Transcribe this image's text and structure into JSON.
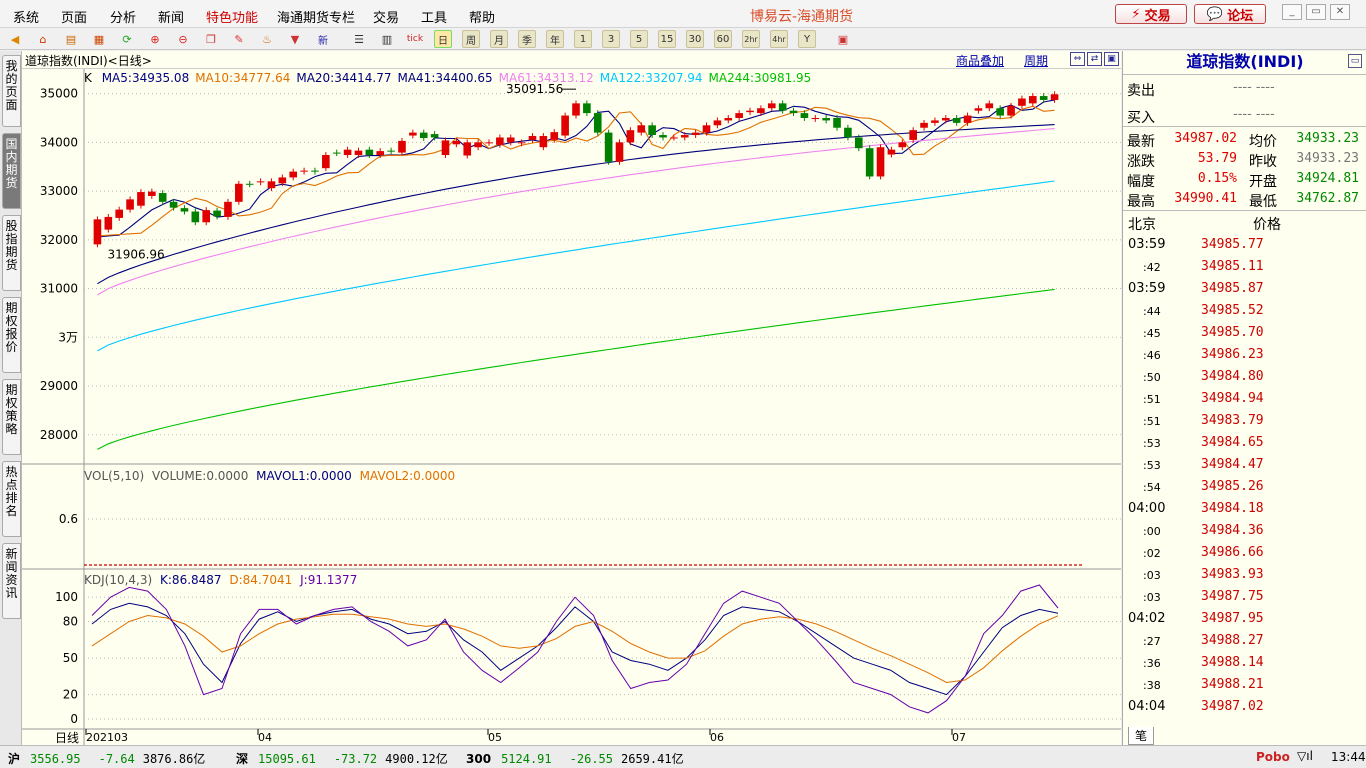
{
  "menu": [
    "系统",
    "页面",
    "分析",
    "新闻",
    "特色功能",
    "海通期货专栏",
    "交易",
    "工具",
    "帮助"
  ],
  "app_title": "博易云-海通期货",
  "top_buttons": {
    "trade": "交易",
    "forum": "论坛"
  },
  "toolbar": {
    "periods": [
      "日",
      "周",
      "月",
      "季",
      "年",
      "1",
      "3",
      "5",
      "15",
      "30",
      "60",
      "2hr",
      "4hr",
      "Y"
    ]
  },
  "sidebar": [
    "我的页面",
    "国内期货",
    "股指期货",
    "期权报价",
    "期权策略",
    "热点排名",
    "新闻资讯"
  ],
  "chart": {
    "title": "道琼指数(INDI)<日线>",
    "header_links": [
      "商品叠加",
      "周期"
    ],
    "ma_line": {
      "k": "K",
      "items": [
        {
          "text": "MA5:34935.08",
          "color": "#000080"
        },
        {
          "text": "MA10:34777.64",
          "color": "#e07000"
        },
        {
          "text": "MA20:34414.77",
          "color": "#00007a"
        },
        {
          "text": "MA41:34400.65",
          "color": "#00007a"
        },
        {
          "text": "MA61:34313.12",
          "color": "#ee82ee"
        },
        {
          "text": "MA122:33207.94",
          "color": "#00c8ff"
        },
        {
          "text": "MA244:30981.95",
          "color": "#00c000"
        }
      ]
    },
    "price_axis": [
      "35000",
      "34000",
      "33000",
      "32000",
      "31000",
      "3万",
      "29000",
      "28000"
    ],
    "high_label": "35091.56",
    "low_label": "31906.96",
    "vol_title": {
      "label": "VOL(5,10)",
      "volume": "VOLUME:0.0000",
      "mavol1": "MAVOL1:0.0000",
      "mavol2": "MAVOL2:0.0000"
    },
    "vol_axis": [
      "0.6"
    ],
    "kdj_title": {
      "label": "KDJ(10,4,3)",
      "k": "K:86.8487",
      "d": "D:84.7041",
      "j": "J:91.1377"
    },
    "kdj_axis": [
      "100",
      "80",
      "50",
      "20",
      "0"
    ],
    "x_axis": {
      "corner": "日线",
      "labels": [
        "202103",
        "04",
        "05",
        "06",
        "07"
      ]
    }
  },
  "quote": {
    "title": "道琼指数(INDI)",
    "sell_label": "卖出",
    "sell_value": "----  ----",
    "buy_label": "买入",
    "buy_value": "----  ----",
    "rows": [
      {
        "l1": "最新",
        "v1": "34987.02",
        "l2": "均价",
        "v2": "34933.23"
      },
      {
        "l1": "涨跌",
        "v1": "53.79",
        "l2": "昨收",
        "v2": "34933.23"
      },
      {
        "l1": "幅度",
        "v1": "0.15%",
        "l2": "开盘",
        "v2": "34924.81"
      },
      {
        "l1": "最高",
        "v1": "34990.41",
        "l2": "最低",
        "v2": "34762.87"
      }
    ],
    "tick_header": {
      "time": "北京",
      "price": "价格"
    },
    "ticks": [
      {
        "t": "03:59",
        "p": "34985.77",
        "main": true
      },
      {
        "t": ":42",
        "p": "34985.11",
        "main": false
      },
      {
        "t": "03:59",
        "p": "34985.87",
        "main": true
      },
      {
        "t": ":44",
        "p": "34985.52",
        "main": false
      },
      {
        "t": ":45",
        "p": "34985.70",
        "main": false
      },
      {
        "t": ":46",
        "p": "34986.23",
        "main": false
      },
      {
        "t": ":50",
        "p": "34984.80",
        "main": false
      },
      {
        "t": ":51",
        "p": "34984.94",
        "main": false
      },
      {
        "t": ":51",
        "p": "34983.79",
        "main": false
      },
      {
        "t": ":53",
        "p": "34984.65",
        "main": false
      },
      {
        "t": ":53",
        "p": "34984.47",
        "main": false
      },
      {
        "t": ":54",
        "p": "34985.26",
        "main": false
      },
      {
        "t": "04:00",
        "p": "34984.18",
        "main": true
      },
      {
        "t": ":00",
        "p": "34984.36",
        "main": false
      },
      {
        "t": ":02",
        "p": "34986.66",
        "main": false
      },
      {
        "t": ":03",
        "p": "34983.93",
        "main": false
      },
      {
        "t": ":03",
        "p": "34987.75",
        "main": false
      },
      {
        "t": "04:02",
        "p": "34987.95",
        "main": true
      },
      {
        "t": ":27",
        "p": "34988.27",
        "main": false
      },
      {
        "t": ":36",
        "p": "34988.14",
        "main": false
      },
      {
        "t": ":38",
        "p": "34988.21",
        "main": false
      },
      {
        "t": "04:04",
        "p": "34987.02",
        "main": true
      }
    ],
    "bottom_tab": "笔"
  },
  "status": {
    "items": [
      {
        "name": "沪",
        "price": "3556.95",
        "chg": "-7.64",
        "amt": "3876.86亿"
      },
      {
        "name": "深",
        "price": "15095.61",
        "chg": "-73.72",
        "amt": "4900.12亿"
      },
      {
        "name": "300",
        "price": "5124.91",
        "chg": "-26.55",
        "amt": "2659.41亿"
      }
    ],
    "brand": "Pobo",
    "clock": "13:44"
  },
  "chart_data": {
    "type": "candlestick",
    "title": "道琼指数(INDI)<日线>",
    "candles": [
      [
        31906.96,
        32420
      ],
      [
        32210,
        32470
      ],
      [
        32450,
        32620
      ],
      [
        32620,
        32830
      ],
      [
        32700,
        32980
      ],
      [
        32900,
        32990
      ],
      [
        32960,
        32780
      ],
      [
        32780,
        32660
      ],
      [
        32650,
        32580
      ],
      [
        32580,
        32360
      ],
      [
        32360,
        32610
      ],
      [
        32600,
        32480
      ],
      [
        32470,
        32780
      ],
      [
        32780,
        33150
      ],
      [
        33150,
        33140
      ],
      [
        33180,
        33200
      ],
      [
        33060,
        33200
      ],
      [
        33160,
        33280
      ],
      [
        33280,
        33400
      ],
      [
        33400,
        33420
      ],
      [
        33420,
        33400
      ],
      [
        33470,
        33740
      ],
      [
        33790,
        33780
      ],
      [
        33740,
        33850
      ],
      [
        33740,
        33830
      ],
      [
        33850,
        33740
      ],
      [
        33740,
        33820
      ],
      [
        33830,
        33820
      ],
      [
        33790,
        34030
      ],
      [
        34140,
        34200
      ],
      [
        34200,
        34090
      ],
      [
        34170,
        34100
      ],
      [
        33740,
        34040
      ],
      [
        33960,
        34030
      ],
      [
        33730,
        34000
      ],
      [
        33900,
        34000
      ],
      [
        33990,
        34000
      ],
      [
        33950,
        34100
      ],
      [
        34000,
        34100
      ],
      [
        33980,
        34000
      ],
      [
        34050,
        34130
      ],
      [
        33900,
        34130
      ],
      [
        34050,
        34210
      ],
      [
        34140,
        34550
      ],
      [
        34550,
        34800
      ],
      [
        34800,
        34600
      ],
      [
        34600,
        34200
      ],
      [
        34200,
        33600
      ],
      [
        33600,
        34000
      ],
      [
        34000,
        34250
      ],
      [
        34200,
        34350
      ],
      [
        34350,
        34150
      ],
      [
        34150,
        34100
      ],
      [
        34100,
        34100
      ],
      [
        34100,
        34150
      ],
      [
        34150,
        34200
      ],
      [
        34200,
        34350
      ],
      [
        34350,
        34450
      ],
      [
        34450,
        34500
      ],
      [
        34500,
        34600
      ],
      [
        34620,
        34650
      ],
      [
        34600,
        34700
      ],
      [
        34700,
        34800
      ],
      [
        34800,
        34650
      ],
      [
        34650,
        34600
      ],
      [
        34600,
        34500
      ],
      [
        34480,
        34500
      ],
      [
        34500,
        34450
      ],
      [
        34500,
        34300
      ],
      [
        34300,
        34100
      ],
      [
        34100,
        33880
      ],
      [
        33880,
        33300
      ],
      [
        33300,
        33900
      ],
      [
        33750,
        33850
      ],
      [
        33900,
        34000
      ],
      [
        34050,
        34250
      ],
      [
        34300,
        34400
      ],
      [
        34400,
        34450
      ],
      [
        34450,
        34500
      ],
      [
        34500,
        34400
      ],
      [
        34400,
        34550
      ],
      [
        34650,
        34700
      ],
      [
        34700,
        34800
      ],
      [
        34700,
        34550
      ],
      [
        34550,
        34750
      ],
      [
        34750,
        34900
      ],
      [
        34800,
        34950
      ],
      [
        34950,
        34870
      ],
      [
        34870,
        34987.02
      ]
    ],
    "ma_series": [
      {
        "name": "MA5",
        "color": "#000080",
        "from": 31550,
        "to": 34935.08,
        "hump": 800
      },
      {
        "name": "MA10",
        "color": "#e07000",
        "from": 31650,
        "to": 34777.64,
        "hump": 700
      },
      {
        "name": "MA20",
        "color": "#00007a",
        "from": 31150,
        "to": 34414.77,
        "hump": 500
      },
      {
        "name": "MA61",
        "color": "#ee82ee",
        "from": 30900,
        "to": 34313.12,
        "hump": 300
      },
      {
        "name": "MA122",
        "color": "#00c8ff",
        "from": 29720,
        "to": 33207.94,
        "hump": 0
      },
      {
        "name": "MA244",
        "color": "#00c000",
        "from": 27700,
        "to": 30981.95,
        "hump": 0
      }
    ],
    "price_range": [
      27400,
      35300
    ],
    "kdj": {
      "K": [
        78,
        90,
        95,
        92,
        85,
        70,
        45,
        30,
        62,
        82,
        88,
        80,
        85,
        88,
        90,
        82,
        78,
        70,
        72,
        80,
        65,
        55,
        40,
        50,
        60,
        75,
        92,
        80,
        55,
        48,
        45,
        40,
        50,
        65,
        85,
        92,
        90,
        88,
        80,
        70,
        60,
        50,
        45,
        40,
        30,
        25,
        20,
        35,
        55,
        75,
        85,
        90,
        86.8487
      ],
      "D": [
        60,
        70,
        80,
        85,
        83,
        78,
        68,
        55,
        60,
        70,
        78,
        82,
        84,
        86,
        86,
        84,
        82,
        78,
        76,
        78,
        74,
        68,
        60,
        58,
        60,
        66,
        76,
        80,
        72,
        62,
        55,
        50,
        50,
        56,
        68,
        78,
        82,
        84,
        82,
        78,
        72,
        65,
        58,
        52,
        45,
        38,
        30,
        32,
        42,
        56,
        68,
        78,
        84.7041
      ],
      "J": [
        85,
        100,
        108,
        105,
        90,
        60,
        20,
        25,
        70,
        90,
        90,
        78,
        85,
        90,
        92,
        80,
        72,
        60,
        65,
        82,
        55,
        40,
        30,
        42,
        55,
        80,
        100,
        85,
        48,
        25,
        30,
        32,
        45,
        70,
        95,
        105,
        100,
        95,
        80,
        65,
        48,
        30,
        25,
        20,
        10,
        5,
        15,
        35,
        70,
        85,
        105,
        110,
        91.1377
      ]
    }
  }
}
